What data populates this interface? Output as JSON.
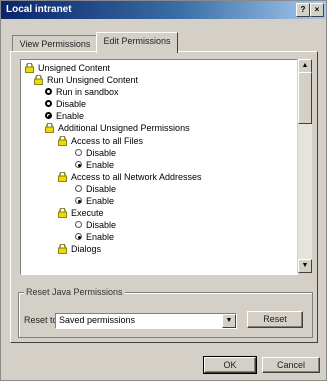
{
  "window": {
    "title": "Local intranet",
    "help_glyph": "?",
    "close_glyph": "×"
  },
  "tabs": [
    {
      "label": "View Permissions"
    },
    {
      "label": "Edit Permissions"
    }
  ],
  "tree": [
    {
      "text": "Unsigned Content",
      "icon": "lock-icon"
    },
    {
      "text": "Run Unsigned Content",
      "icon": "lock-icon"
    },
    {
      "text": "Run in sandbox",
      "checked": false
    },
    {
      "text": "Disable",
      "checked": false
    },
    {
      "text": "Enable",
      "checked": true
    },
    {
      "text": "Additional Unsigned Permissions",
      "icon": "lock-icon"
    },
    {
      "text": "Access to all Files",
      "icon": "lock-icon"
    },
    {
      "text": "Disable",
      "checked": false
    },
    {
      "text": "Enable",
      "checked": true
    },
    {
      "text": "Access to all Network Addresses",
      "icon": "lock-icon"
    },
    {
      "text": "Disable",
      "checked": false
    },
    {
      "text": "Enable",
      "checked": true
    },
    {
      "text": "Execute",
      "icon": "lock-icon"
    },
    {
      "text": "Disable",
      "checked": false
    },
    {
      "text": "Enable",
      "checked": true
    },
    {
      "text": "Dialogs",
      "icon": "lock-icon"
    }
  ],
  "reset_group": {
    "title": "Reset Java Permissions",
    "reset_to_label": "Reset to:",
    "selected_value": "Saved permissions",
    "reset_button": "Reset"
  },
  "footer": {
    "ok": "OK",
    "cancel": "Cancel"
  },
  "colors": {
    "title_bar_start": "#0a246a",
    "title_bar_end": "#a6caf0",
    "dialog_face": "#d4d0c8"
  }
}
